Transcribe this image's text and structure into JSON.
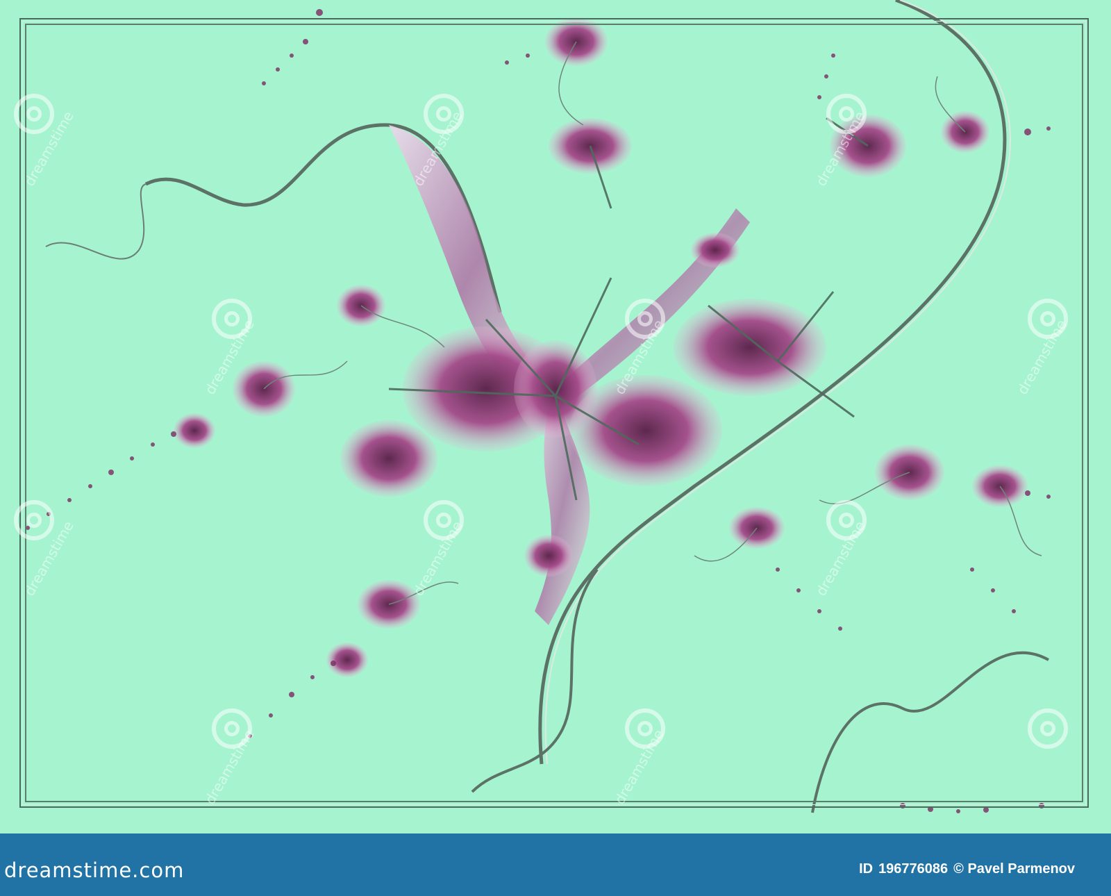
{
  "image": {
    "description_colors": {
      "background": "#a5f4cf",
      "flower": "#8a3a72",
      "stem": "#6a7a70",
      "footer": "#2173a6"
    }
  },
  "watermark": {
    "text": "dreamstime",
    "icon": "spiral-icon"
  },
  "footer": {
    "logo": "dreamstime.com",
    "id_label": "ID",
    "id_value": "196776086",
    "credit": "© Pavel Parmenov"
  }
}
